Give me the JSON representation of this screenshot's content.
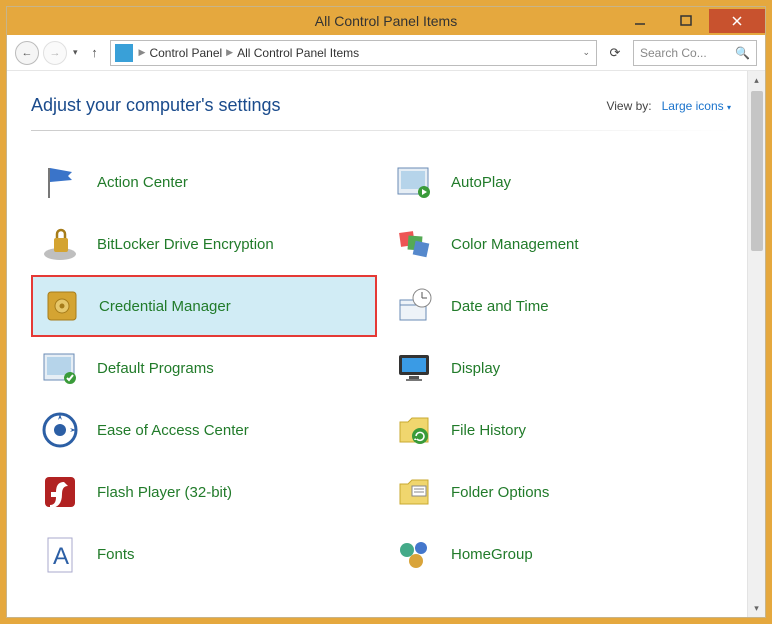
{
  "window": {
    "title": "All Control Panel Items"
  },
  "breadcrumb": {
    "level1": "Control Panel",
    "level2": "All Control Panel Items"
  },
  "search": {
    "placeholder": "Search Co..."
  },
  "header": {
    "title": "Adjust your computer's settings",
    "viewby_label": "View by:",
    "viewby_value": "Large icons"
  },
  "items": {
    "i0": "Action Center",
    "i1": "AutoPlay",
    "i2": "BitLocker Drive Encryption",
    "i3": "Color Management",
    "i4": "Credential Manager",
    "i5": "Date and Time",
    "i6": "Default Programs",
    "i7": "Display",
    "i8": "Ease of Access Center",
    "i9": "File History",
    "i10": "Flash Player (32-bit)",
    "i11": "Folder Options",
    "i12": "Fonts",
    "i13": "HomeGroup"
  },
  "selected_index": 4
}
